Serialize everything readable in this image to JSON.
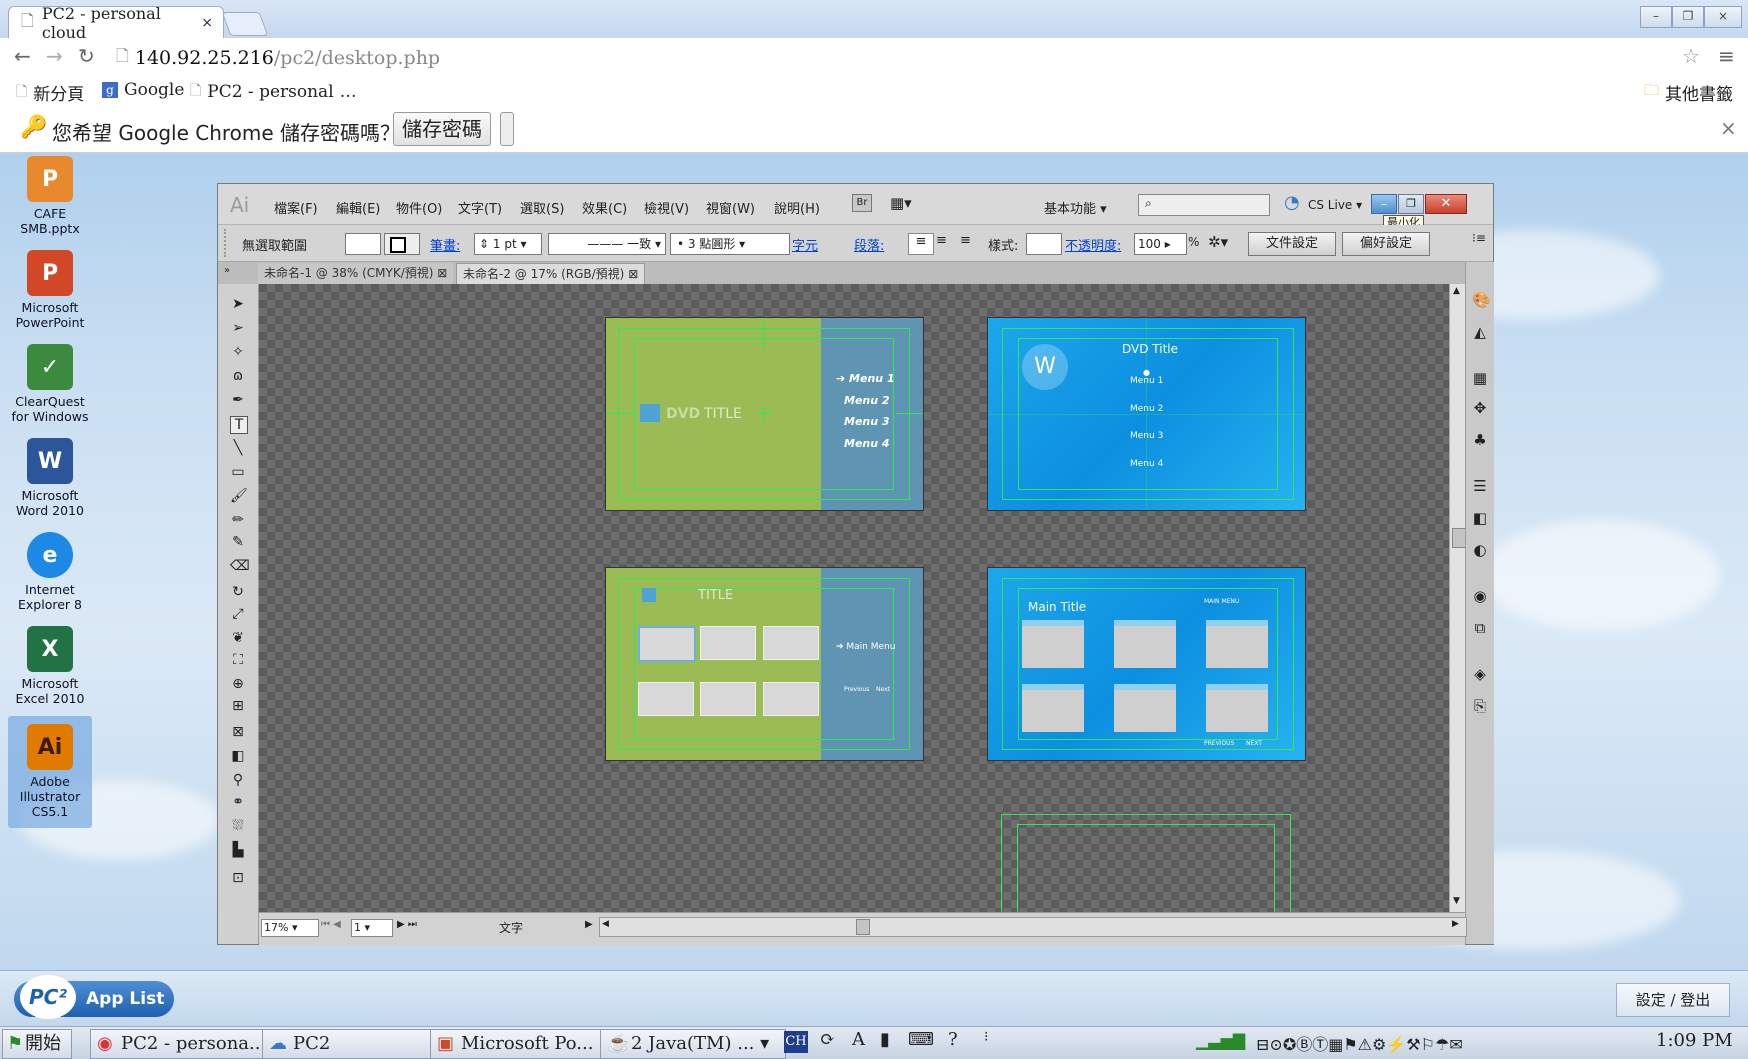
{
  "browser": {
    "tab_title": "PC2 - personal cloud",
    "tab_close": "×",
    "url_host": "140.92.25.216",
    "url_path": "/pc2/desktop.php",
    "bookmarks": [
      "新分頁",
      "Google",
      "PC2 - personal"
    ],
    "bookmarks_more": "…",
    "other_bookmarks": "其他書籤",
    "infobar_text": "您希望 Google Chrome 儲存密碼嗎？",
    "infobar_button": "儲存密碼",
    "infobar_close": "×",
    "window_buttons": [
      "–",
      "❐",
      "×"
    ]
  },
  "desktop_icons": [
    {
      "label": "CAFE SMB.pptx",
      "icon": "pptx-file-icon",
      "color": "#e8892e"
    },
    {
      "label": "Microsoft PowerPoint",
      "icon": "powerpoint-icon",
      "color": "#d24726"
    },
    {
      "label": "ClearQuest for Windows",
      "icon": "clearquest-icon",
      "color": "#3b8a3e"
    },
    {
      "label": "Microsoft Word 2010",
      "icon": "word-icon",
      "color": "#2b579a"
    },
    {
      "label": "Internet Explorer 8",
      "icon": "ie-icon",
      "color": "#1e88e5"
    },
    {
      "label": "Microsoft Excel 2010",
      "icon": "excel-icon",
      "color": "#217346"
    },
    {
      "label": "Adobe Illustrator CS5.1",
      "icon": "illustrator-icon",
      "color": "#e07b00"
    }
  ],
  "illustrator": {
    "logo": "Ai",
    "menus": [
      "檔案(F)",
      "編輯(E)",
      "物件(O)",
      "文字(T)",
      "選取(S)",
      "效果(C)",
      "檢視(V)",
      "視窗(W)",
      "說明(H)"
    ],
    "br_button": "Br",
    "workspace": "基本功能",
    "cs_live": "CS Live",
    "minimize_tooltip": "最小化",
    "control": {
      "selection": "無選取範圍",
      "stroke_label": "筆畫:",
      "stroke_weight": "1 pt",
      "stroke_style": "一致",
      "brush": "3 點圓形",
      "char_label": "字元",
      "para_label": "段落:",
      "style_label": "樣式:",
      "opacity_label": "不透明度:",
      "opacity_value": "100",
      "opacity_unit": "%",
      "doc_setup": "文件設定",
      "preferences": "偏好設定"
    },
    "doc_tabs": [
      "未命名-1 @ 38% (CMYK/預視)",
      "未命名-2 @ 17% (RGB/預視)"
    ],
    "status": {
      "zoom": "17%",
      "page": "1",
      "info": "文字"
    }
  },
  "artboards": {
    "green1": {
      "logo_text": "DVD",
      "title": "TITLE",
      "menus": [
        "Menu 1",
        "Menu 2",
        "Menu 3",
        "Menu 4"
      ]
    },
    "blue1": {
      "title": "DVD Title",
      "menus": [
        "Menu 1",
        "Menu 2",
        "Menu 3",
        "Menu 4"
      ]
    },
    "green2": {
      "title": "TITLE",
      "main_menu": "Main Menu",
      "previous": "Previous",
      "next": "Next"
    },
    "blue2": {
      "title": "Main Title",
      "main_menu": "MAIN MENU",
      "previous": "PREVIOUS",
      "next": "NEXT"
    }
  },
  "applist": {
    "logo": "PC²",
    "label": "App List",
    "setting": "設定 / 登出"
  },
  "taskbar": {
    "start": "開始",
    "buttons": [
      "PC2 - persona...",
      "PC2",
      "Microsoft Po...",
      "2 Java(TM) ..."
    ],
    "ime": "CH",
    "clock": "1:09 PM"
  }
}
